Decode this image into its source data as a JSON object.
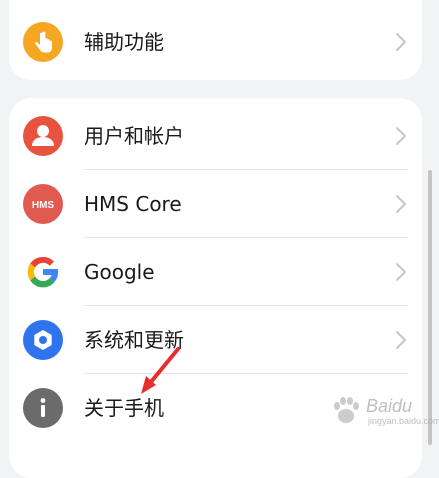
{
  "settings": {
    "accessibility": {
      "label": "辅助功能",
      "icon": "hand-pointer-icon",
      "icon_color": "#f5a623"
    },
    "items": [
      {
        "label": "用户和帐户",
        "icon": "user-icon",
        "icon_color": "#e8533f"
      },
      {
        "label": "HMS Core",
        "icon": "hms-logo-icon",
        "icon_color": "#e05a4f",
        "badge": "HMS"
      },
      {
        "label": "Google",
        "icon": "google-g-icon",
        "icon_color": "#ffffff"
      },
      {
        "label": "系统和更新",
        "icon": "gear-icon",
        "icon_color": "#2f74ee"
      },
      {
        "label": "关于手机",
        "icon": "info-icon",
        "icon_color": "#6b6b6b"
      }
    ]
  },
  "colors": {
    "background": "#f1f3f5",
    "card": "#ffffff",
    "text": "#1a1a1a",
    "chevron": "#c7c7c7",
    "arrow": "#e62e2e"
  },
  "watermark": {
    "brand": "Baidu",
    "sub": "jingyan.baidu.com"
  }
}
